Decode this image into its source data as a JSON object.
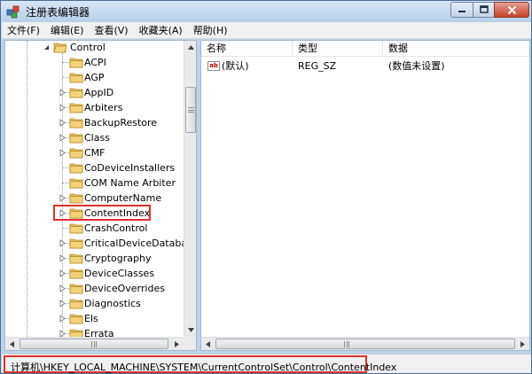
{
  "window": {
    "title": "注册表编辑器"
  },
  "menu": [
    {
      "id": "file",
      "label": "文件(F)"
    },
    {
      "id": "edit",
      "label": "编辑(E)"
    },
    {
      "id": "view",
      "label": "查看(V)"
    },
    {
      "id": "favorites",
      "label": "收藏夹(A)"
    },
    {
      "id": "help",
      "label": "帮助(H)"
    }
  ],
  "tree": {
    "parent": {
      "label": "Control",
      "expanded": true
    },
    "items": [
      {
        "label": "ACPI",
        "has_children": false
      },
      {
        "label": "AGP",
        "has_children": false
      },
      {
        "label": "AppID",
        "has_children": true
      },
      {
        "label": "Arbiters",
        "has_children": true
      },
      {
        "label": "BackupRestore",
        "has_children": true
      },
      {
        "label": "Class",
        "has_children": true
      },
      {
        "label": "CMF",
        "has_children": true
      },
      {
        "label": "CoDeviceInstallers",
        "has_children": false
      },
      {
        "label": "COM Name Arbiter",
        "has_children": false
      },
      {
        "label": "ComputerName",
        "has_children": true
      },
      {
        "label": "ContentIndex",
        "has_children": true,
        "selected": true
      },
      {
        "label": "CrashControl",
        "has_children": false
      },
      {
        "label": "CriticalDeviceDatabase",
        "has_children": true
      },
      {
        "label": "Cryptography",
        "has_children": true
      },
      {
        "label": "DeviceClasses",
        "has_children": true
      },
      {
        "label": "DeviceOverrides",
        "has_children": true
      },
      {
        "label": "Diagnostics",
        "has_children": true
      },
      {
        "label": "Els",
        "has_children": true
      },
      {
        "label": "Errata",
        "has_children": true
      }
    ]
  },
  "list": {
    "columns": [
      "名称",
      "类型",
      "数据"
    ],
    "rows": [
      {
        "name": "(默认)",
        "type": "REG_SZ",
        "data": "(数值未设置)",
        "icon": "string-value-icon"
      }
    ]
  },
  "status": {
    "path": "计算机\\HKEY_LOCAL_MACHINE\\SYSTEM\\CurrentControlSet\\Control\\ContentIndex"
  },
  "colors": {
    "highlight": "#e0312f",
    "folder": "#e8c25a",
    "chrome": "#bcd3ea"
  }
}
